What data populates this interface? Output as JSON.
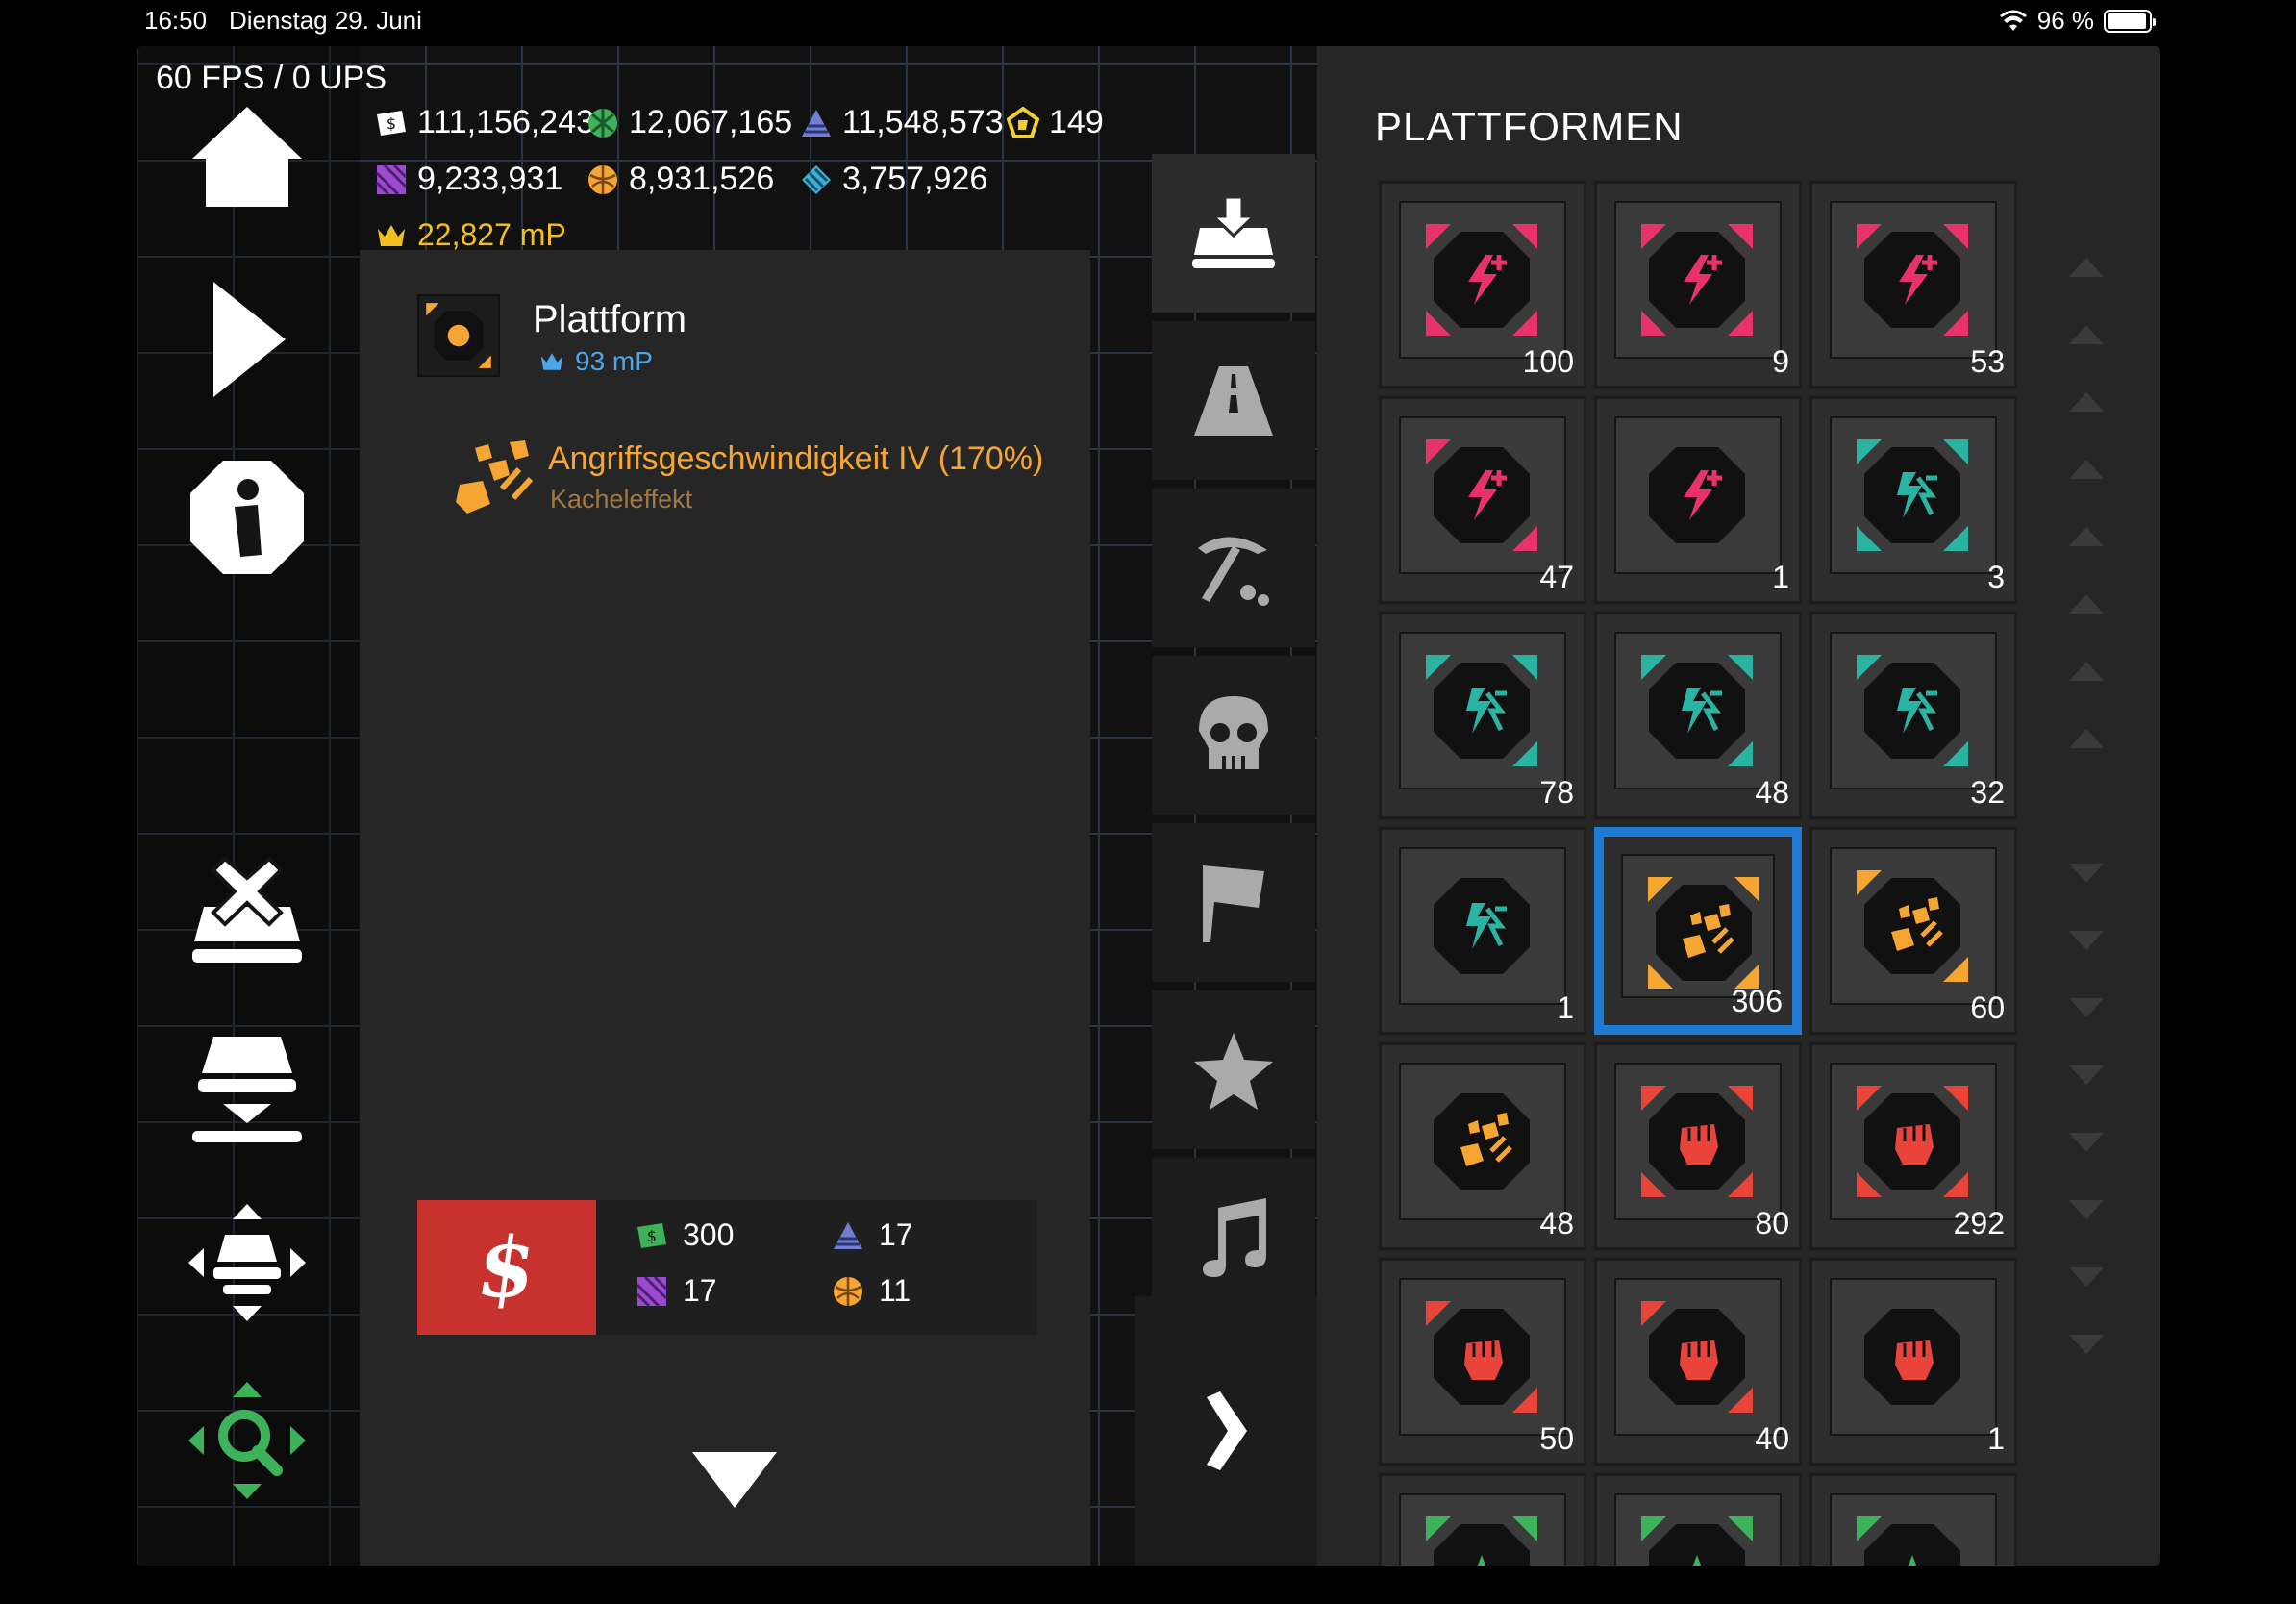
{
  "statusbar": {
    "time": "16:50",
    "date": "Dienstag 29. Juni",
    "battery": "96 %",
    "battery_level": 0.96
  },
  "hud": {
    "fps": "60 FPS / 0 UPS"
  },
  "resources": {
    "money": "111,156,243",
    "green": "12,067,165",
    "blue_pyramid": "11,548,573",
    "gold_pentagon": "149",
    "purple": "9,233,931",
    "orange": "8,931,526",
    "cyan": "3,757,926",
    "mp": "22,827 mP"
  },
  "colors": {
    "accent_blue": "#1f7ad4",
    "sell_red": "#c8322e",
    "effect_orange": "#f5a531",
    "price_blue": "#4aa8e8",
    "pink": "#e8336a",
    "teal": "#2ab3a3",
    "red": "#e8443a",
    "green": "#3db25a"
  },
  "detail": {
    "title": "Plattform",
    "price": "93 mP",
    "effect_title": "Angriffsgeschwindigkeit IV (170%)",
    "effect_sub": "Kacheleffekt",
    "sell_symbol": "$",
    "costs": {
      "money": "300",
      "pyramid": "17",
      "purple": "17",
      "orange": "11"
    }
  },
  "panel": {
    "title": "PLATTFORMEN",
    "tiles": [
      {
        "count": "100",
        "kind": "pink",
        "level": 4
      },
      {
        "count": "9",
        "kind": "pink",
        "level": 4
      },
      {
        "count": "53",
        "kind": "pink",
        "level": 3
      },
      {
        "count": "47",
        "kind": "pink",
        "level": 2
      },
      {
        "count": "1",
        "kind": "pink",
        "level": 1
      },
      {
        "count": "3",
        "kind": "teal",
        "level": 4
      },
      {
        "count": "78",
        "kind": "teal",
        "level": 3
      },
      {
        "count": "48",
        "kind": "teal",
        "level": 3
      },
      {
        "count": "32",
        "kind": "teal",
        "level": 2
      },
      {
        "count": "1",
        "kind": "teal",
        "level": 1
      },
      {
        "count": "306",
        "kind": "orange",
        "level": 4
      },
      {
        "count": "60",
        "kind": "orange",
        "level": 2
      },
      {
        "count": "48",
        "kind": "orange",
        "level": 1
      },
      {
        "count": "80",
        "kind": "red",
        "level": 4
      },
      {
        "count": "292",
        "kind": "red",
        "level": 4
      },
      {
        "count": "50",
        "kind": "red",
        "level": 2
      },
      {
        "count": "40",
        "kind": "red",
        "level": 2
      },
      {
        "count": "1",
        "kind": "red",
        "level": 1
      },
      {
        "count": "",
        "kind": "green",
        "level": 4
      },
      {
        "count": "",
        "kind": "green",
        "level": 4
      },
      {
        "count": "",
        "kind": "green",
        "level": 2
      }
    ],
    "selected_index": 10
  },
  "icons": {
    "left": [
      "home-icon",
      "play-icon",
      "info-icon",
      "delete-platform-icon",
      "place-platform-icon",
      "move-icon",
      "zoom-search-icon"
    ],
    "tabs": [
      "platform-tab-icon",
      "road-icon",
      "pickaxe-icon",
      "skull-icon",
      "flag-icon",
      "star-icon",
      "music-icon"
    ]
  }
}
